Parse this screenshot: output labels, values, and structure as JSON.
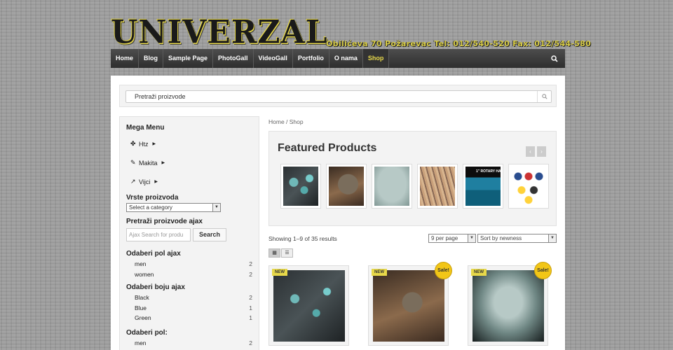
{
  "header": {
    "logo_text": "UNIVERZAL",
    "tagline": "Obilićeva 70 Požarevac  Tel: 012/540-520  Fax: 012/544-580"
  },
  "nav": {
    "items": [
      "Home",
      "Blog",
      "Sample Page",
      "PhotoGall",
      "VideoGall",
      "Portfolio",
      "O nama",
      "Shop"
    ],
    "active": "Shop"
  },
  "search": {
    "placeholder": "Pretraži proizvode"
  },
  "sidebar": {
    "mega_menu_title": "Mega Menu",
    "mega_menu_items": [
      {
        "label": "Htz",
        "icon": "puzzle-icon"
      },
      {
        "label": "Makita",
        "icon": "drill-icon"
      },
      {
        "label": "Vijci",
        "icon": "screw-icon"
      }
    ],
    "categories_title": "Vrste proizvoda",
    "categories_select": "Select a category",
    "ajax_title": "Pretraži proizvode ajax",
    "ajax_placeholder": "Ajax Search for produ",
    "ajax_button": "Search",
    "gender_ajax_title": "Odaberi pol ajax",
    "gender_ajax": [
      {
        "label": "men",
        "count": "2"
      },
      {
        "label": "women",
        "count": "2"
      }
    ],
    "color_ajax_title": "Odaberi boju ajax",
    "color_ajax": [
      {
        "label": "Black",
        "count": "2"
      },
      {
        "label": "Blue",
        "count": "1"
      },
      {
        "label": "Green",
        "count": "1"
      }
    ],
    "gender_title": "Odaberi pol:",
    "gender_partial": {
      "label": "men",
      "count": "2"
    }
  },
  "content": {
    "breadcrumb": "Home / Shop",
    "featured_title": "Featured Products",
    "carousel_prev": "‹",
    "carousel_next": "›",
    "rotary_text": "1\" ROTARY HA",
    "results_text": "Showing 1–9 of 35 results",
    "per_page": "9 per page",
    "sort": "Sort by newness",
    "badge_new": "NEW",
    "badge_sale": "Sale!"
  },
  "colors": {
    "accent_yellow": "#e7d84a",
    "nav_bg": "#3a3a3a",
    "sale_badge": "#f2c617"
  }
}
